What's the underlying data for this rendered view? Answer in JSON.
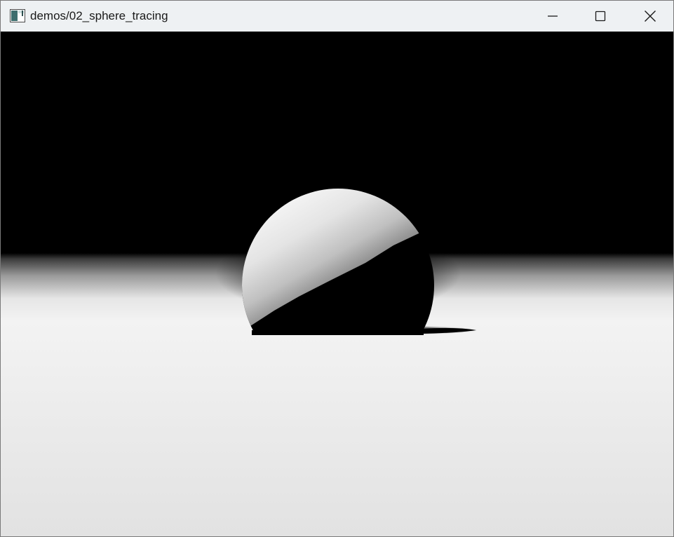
{
  "window": {
    "title": "demos/02_sphere_tracing",
    "icons": {
      "app": "app-window-icon",
      "minimize": "minimize-icon",
      "maximize": "maximize-icon",
      "close": "close-icon"
    }
  },
  "scene": {
    "description_type": "rendered-3d-viewport",
    "objects": [
      "sphere",
      "floor-plane",
      "shadow"
    ],
    "colors": {
      "sky": "#000000",
      "floor_far": "#3a3a3a",
      "floor_near": "#f2f2f2",
      "floor_bottom": "#e2e2e2",
      "sphere_lit": "#f4f4f4",
      "sphere_shadow": "#000000"
    }
  }
}
